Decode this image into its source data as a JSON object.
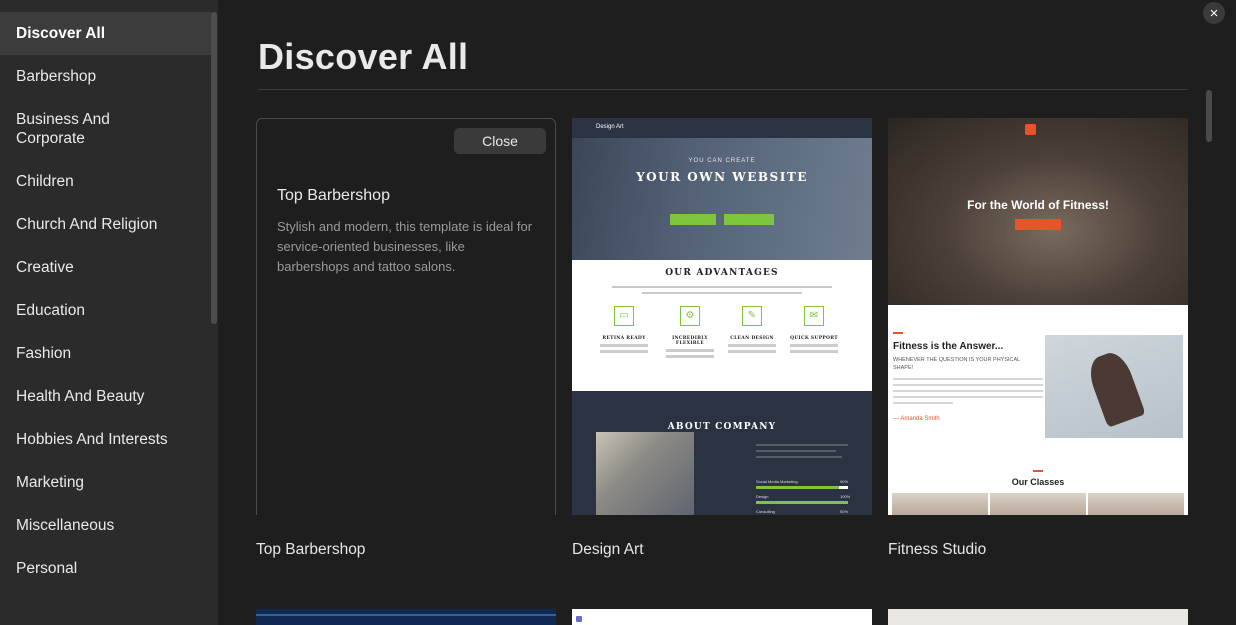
{
  "sidebar": {
    "items": [
      {
        "label": "Discover All",
        "active": true
      },
      {
        "label": "Barbershop"
      },
      {
        "label": "Business And Corporate"
      },
      {
        "label": "Children"
      },
      {
        "label": "Church And Religion"
      },
      {
        "label": "Creative"
      },
      {
        "label": "Education"
      },
      {
        "label": "Fashion"
      },
      {
        "label": "Health And Beauty"
      },
      {
        "label": "Hobbies And Interests"
      },
      {
        "label": "Marketing"
      },
      {
        "label": "Miscellaneous"
      },
      {
        "label": "Personal"
      }
    ]
  },
  "main": {
    "title": "Discover All",
    "close_icon": "×",
    "cards": [
      {
        "name": "Top Barbershop",
        "info": {
          "close_label": "Close",
          "title": "Top Barbershop",
          "description": "Stylish and modern, this template is ideal for service-oriented businesses, like barbershops and tattoo salons."
        }
      },
      {
        "name": "Design Art",
        "preview": {
          "logo": "Design Art",
          "hero_small": "YOU CAN CREATE",
          "hero_big": "YOUR OWN WEBSITE",
          "advantages_title": "OUR ADVANTAGES",
          "features": [
            "RETINA READY",
            "INCREDIBLY FLEXIBLE",
            "CLEAN DESIGN",
            "QUICK SUPPORT"
          ],
          "about_title": "ABOUT COMPANY",
          "bars": [
            {
              "label": "Social Media Marketing",
              "value": "90%",
              "pct": 0.9
            },
            {
              "label": "Design",
              "value": "100%",
              "pct": 1.0
            },
            {
              "label": "Consulting",
              "value": "50%",
              "pct": 0.5
            }
          ]
        }
      },
      {
        "name": "Fitness Studio",
        "preview": {
          "hero_title": "For the World of Fitness!",
          "heading": "Fitness is the Answer...",
          "subheading": "WHENEVER THE QUESTION IS YOUR PHYSICAL SHAPE!",
          "author": "— Amanda Smith",
          "classes_title": "Our Classes"
        }
      }
    ]
  },
  "colors": {
    "sidebar_bg": "#2b2b2b",
    "main_bg": "#1e1e1e",
    "accent_green": "#7dc53f",
    "accent_orange": "#e8542a"
  }
}
